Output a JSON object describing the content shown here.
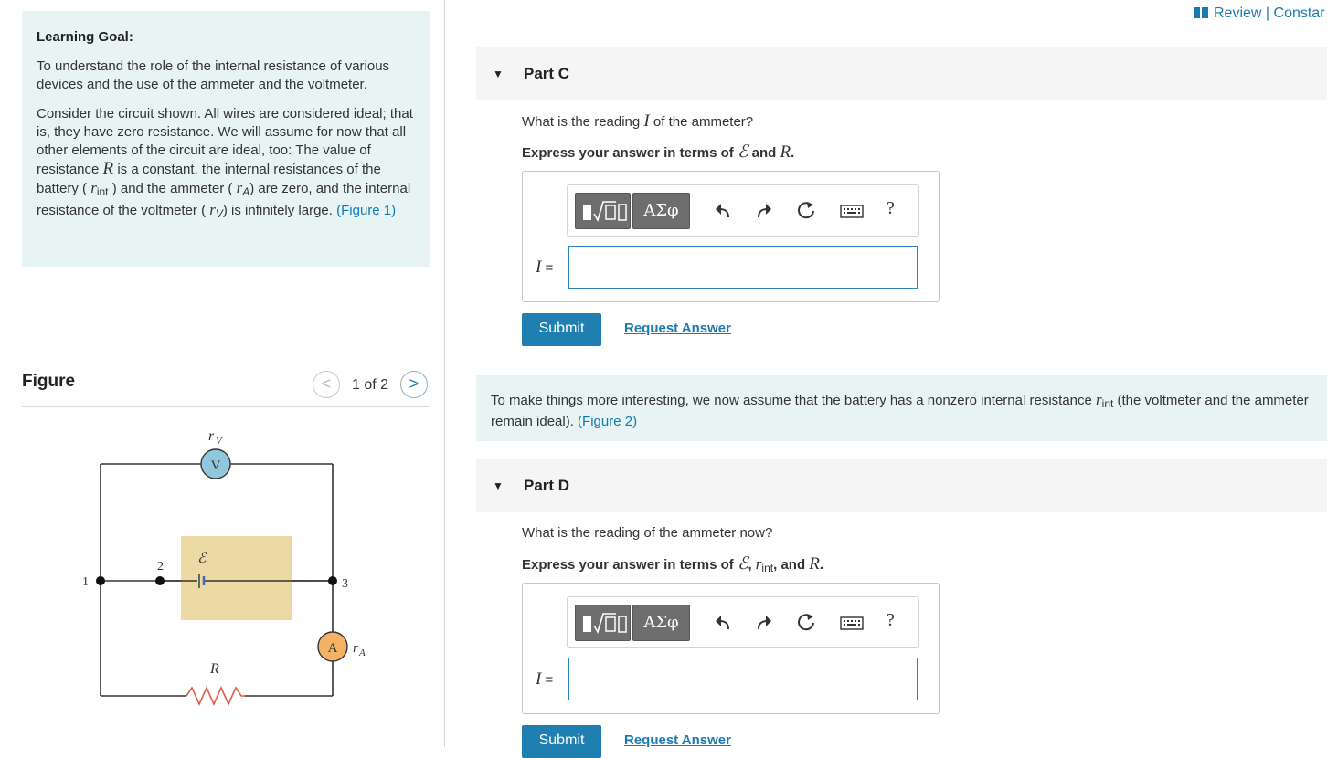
{
  "learning_goal": {
    "title": "Learning Goal:",
    "intro": "To understand the role of the internal resistance of various devices and the use of the ammeter and the voltmeter.",
    "p1": "Consider the circuit shown. All wires are considered ideal; that is, they have zero resistance. We will assume for now that all other elements of the circuit are ideal, too: The value of resistance",
    "p2": "is a constant, the internal resistances of the battery (",
    "p3": ") and the ammeter (",
    "p4": ") are zero, and the internal resistance of the voltmeter (",
    "p5": ") is infinitely large.",
    "figure_link": "(Figure 1)"
  },
  "figure": {
    "title": "Figure",
    "counter": "1 of 2",
    "prev_symbol": "<",
    "next_symbol": ">",
    "labels": {
      "rV": "r",
      "rV_sub": "V",
      "V": "V",
      "emf": "ℰ",
      "node1": "1",
      "node2": "2",
      "node3": "3",
      "A": "A",
      "rA": "r",
      "rA_sub": "A",
      "R": "R"
    }
  },
  "header": {
    "review_text": "Review | Constar"
  },
  "part_c": {
    "title": "Part C",
    "question_pre": "What is the reading",
    "question_var": "I",
    "question_post": "of the ammeter?",
    "express_pre": "Express your answer in terms of",
    "express_mid": "and",
    "answer_label": "I =",
    "submit": "Submit",
    "request": "Request Answer"
  },
  "intro2": {
    "text_pre": "To make things more interesting, we now assume that the battery has a nonzero internal resistance",
    "text_post": "(the voltmeter and the ammeter remain ideal).",
    "figure_link": "(Figure 2)"
  },
  "part_d": {
    "title": "Part D",
    "question": "What is the reading of the ammeter now?",
    "express_pre": "Express your answer in terms of",
    "express_comma": ",",
    "express_and": ", and",
    "answer_label": "I =",
    "submit": "Submit",
    "request": "Request Answer"
  },
  "math": {
    "R": "R",
    "emf": "ℰ",
    "r": "r",
    "int": "int",
    "A": "A",
    "V": "V",
    "dot": "."
  },
  "toolbar": {
    "greek_label": "ΑΣφ",
    "help": "?",
    "icons": [
      "template-icon",
      "undo-icon",
      "redo-icon",
      "reset-icon",
      "keyboard-icon",
      "help-icon"
    ]
  },
  "colors": {
    "accent": "#1e7fb0",
    "goal_bg": "#e8f4f4",
    "part_header_bg": "#f5f5f5",
    "voltmeter": "#8fc8dc",
    "ammeter": "#f4b266",
    "battery_box": "#ecd9a3",
    "resistor": "#e05a4a"
  }
}
